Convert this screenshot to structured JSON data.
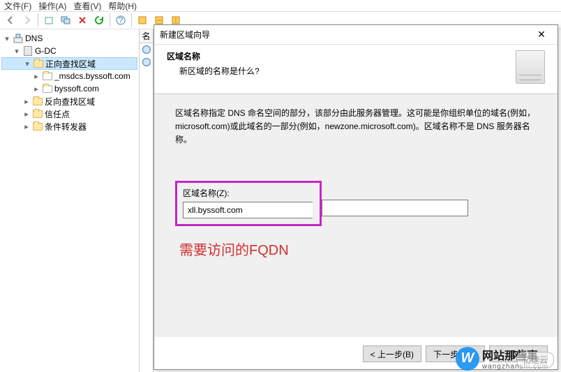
{
  "menu": {
    "file": "文件(F)",
    "action": "操作(A)",
    "view": "查看(V)",
    "help": "帮助(H)"
  },
  "tree": {
    "root": "DNS",
    "server": "G-DC",
    "fwd": "正向查找区域",
    "z1": "_msdcs.byssoft.com",
    "z2": "byssoft.com",
    "rev": "反向查找区域",
    "trust": "信任点",
    "cond": "条件转发器"
  },
  "listhdr": "名",
  "dialog": {
    "title": "新建区域向导",
    "h": "区域名称",
    "sub": "新区域的名称是什么?",
    "desc": "区域名称指定 DNS 命名空间的部分，该部分由此服务器管理。这可能是你组织单位的域名(例如，microsoft.com)或此域名的一部分(例如，newzone.microsoft.com)。区域名称不是 DNS 服务器名称。",
    "label": "区域名称(Z):",
    "value": "xll.byssoft.com",
    "anno": "需要访问的FQDN",
    "back": "< 上一步(B)",
    "next": "下一步(N) >",
    "cancel": "取消"
  },
  "wm": {
    "brand": "网站那些事",
    "url": "wangzhanshi.com",
    "yz": "亿速云"
  }
}
